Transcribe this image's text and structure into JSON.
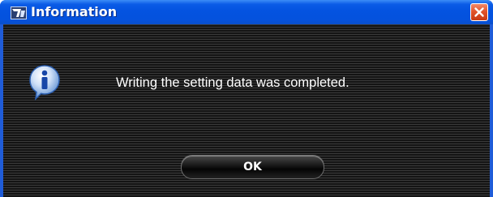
{
  "window": {
    "title": "Information",
    "app_icon": "app-logo-icon",
    "close_icon": "close-icon"
  },
  "dialog": {
    "icon": "info-icon",
    "message": "Writing the setting data was completed.",
    "ok_label": "OK"
  },
  "colors": {
    "titlebar": "#0452dd",
    "close_button": "#d9481f",
    "client_background": "#1a1a1a",
    "text": "#ffffff"
  }
}
